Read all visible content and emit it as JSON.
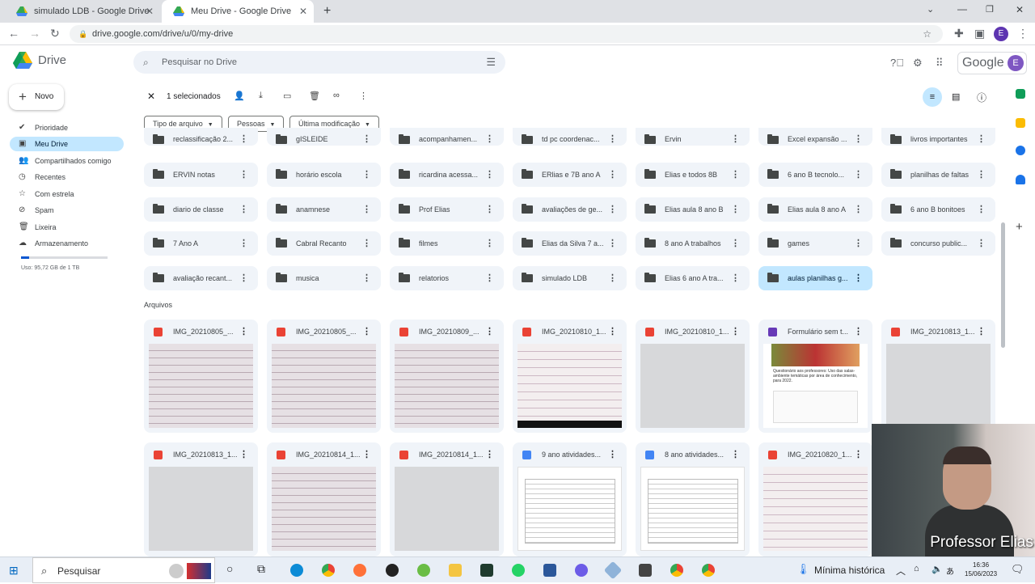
{
  "browser": {
    "tabs": [
      {
        "title": "simulado LDB - Google Drive",
        "active": false
      },
      {
        "title": "Meu Drive - Google Drive",
        "active": true
      }
    ],
    "url": "drive.google.com/drive/u/0/my-drive"
  },
  "header": {
    "app_name": "Drive",
    "search_placeholder": "Pesquisar no Drive",
    "account_brand": "Google",
    "avatar_letter": "E"
  },
  "sidebar": {
    "new_label": "Novo",
    "items": [
      {
        "label": "Prioridade",
        "icon": "check-circle-icon"
      },
      {
        "label": "Meu Drive",
        "icon": "drive-icon",
        "selected": true
      },
      {
        "label": "Compartilhados comigo",
        "icon": "people-icon"
      },
      {
        "label": "Recentes",
        "icon": "clock-icon"
      },
      {
        "label": "Com estrela",
        "icon": "star-icon"
      },
      {
        "label": "Spam",
        "icon": "spam-icon"
      },
      {
        "label": "Lixeira",
        "icon": "trash-icon"
      },
      {
        "label": "Armazenamento",
        "icon": "cloud-icon"
      }
    ],
    "storage_text": "Uso: 95,72 GB de 1 TB",
    "storage_fraction": 0.09
  },
  "selection": {
    "count_label": "1 selecionados"
  },
  "filters": [
    "Tipo de arquivo",
    "Pessoas",
    "Última modificação"
  ],
  "folders": [
    [
      "reclassificação 2...",
      "gISLEIDE",
      "acompanhamen...",
      "td pc coordenac...",
      "Ervin",
      "Excel expansão ...",
      "livros importantes"
    ],
    [
      "ERVIN notas",
      "horário escola",
      "ricardina acessa...",
      "ERlias e 7B ano A",
      "Elias e todos 8B",
      "6 ano B tecnolo...",
      "planilhas de faltas"
    ],
    [
      "diario de classe",
      "anamnese",
      "Prof Elias",
      "avaliações de ge...",
      "Elias aula 8 ano B",
      "Elias aula 8 ano A",
      "6 ano B bonitoes"
    ],
    [
      "7 Ano A",
      "Cabral Recanto",
      "filmes",
      "Elias da Silva 7 a...",
      "8 ano A trabalhos",
      "games",
      "concurso public..."
    ],
    [
      "avaliação recant...",
      "musica",
      "relatorios",
      "simulado LDB",
      "Elias 6 ano A tra...",
      "aulas planilhas g..."
    ]
  ],
  "selected_folder": "aulas planilhas g...",
  "files_section_label": "Arquivos",
  "files": [
    [
      {
        "name": "IMG_20210805_...",
        "type": "image",
        "thumb": "paper"
      },
      {
        "name": "IMG_20210805_...",
        "type": "image",
        "thumb": "paper"
      },
      {
        "name": "IMG_20210809_...",
        "type": "image",
        "thumb": "paper"
      },
      {
        "name": "IMG_20210810_1...",
        "type": "image",
        "thumb": "pink"
      },
      {
        "name": "IMG_20210810_1...",
        "type": "image",
        "thumb": "gray"
      },
      {
        "name": "Formulário sem t...",
        "type": "form",
        "thumb": "form"
      },
      {
        "name": "IMG_20210813_1...",
        "type": "image",
        "thumb": "gray"
      }
    ],
    [
      {
        "name": "IMG_20210813_1...",
        "type": "image",
        "thumb": "gray"
      },
      {
        "name": "IMG_20210814_1...",
        "type": "image",
        "thumb": "paper"
      },
      {
        "name": "IMG_20210814_1...",
        "type": "image",
        "thumb": "gray"
      },
      {
        "name": "9 ano atividades...",
        "type": "doc",
        "thumb": "doc"
      },
      {
        "name": "8 ano atividades...",
        "type": "doc",
        "thumb": "doc"
      },
      {
        "name": "IMG_20210820_1...",
        "type": "image",
        "thumb": "pink"
      }
    ]
  ],
  "form_thumb_text": "Questionário aos professores: Uso das salas- ambiente temáticas por área de conhecimento, para 2022.",
  "webcam_label": "Professor Elias",
  "taskbar": {
    "search_label": "Pesquisar",
    "weather_label": "Mínima histórica",
    "time": "16:36",
    "date": "15/06/2023"
  },
  "colors": {
    "selected_bg": "#c2e7ff",
    "card_bg": "#f0f4f9",
    "accent": "#0b57d0"
  }
}
